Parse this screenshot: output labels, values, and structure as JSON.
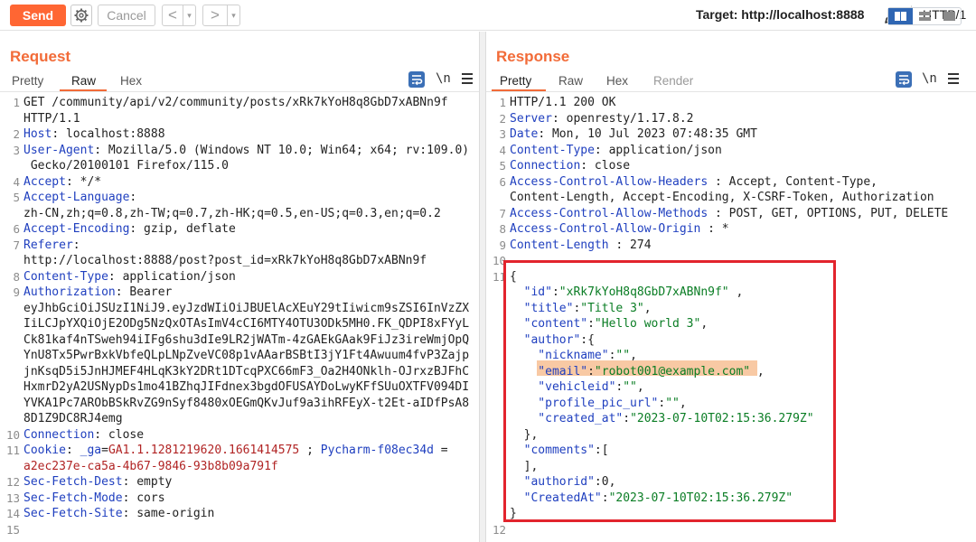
{
  "toolbar": {
    "send_label": "Send",
    "cancel_label": "Cancel",
    "back_glyph": "<",
    "forward_glyph": ">",
    "dropdown_glyph": "▾",
    "target_label": "Target: http://localhost:8888",
    "http_version": "HTTP/1",
    "send_color": "#ff6633"
  },
  "request": {
    "title": "Request",
    "tabs": [
      "Pretty",
      "Raw",
      "Hex"
    ],
    "active_tab": "Raw",
    "ln_icon": "\\n",
    "lines": [
      {
        "n": "1",
        "segs": [
          {
            "t": "GET /community/api/v2/community/posts/xRk7kYoH8q8GbD7xABNn9f",
            "c": ""
          }
        ]
      },
      {
        "n": "",
        "segs": [
          {
            "t": "HTTP/1.1",
            "c": ""
          }
        ]
      },
      {
        "n": "2",
        "segs": [
          {
            "t": "Host",
            "c": "key"
          },
          {
            "t": ": localhost:8888",
            "c": ""
          }
        ]
      },
      {
        "n": "3",
        "segs": [
          {
            "t": "User-Agent",
            "c": "key"
          },
          {
            "t": ": Mozilla/5.0 (Windows NT 10.0; Win64; x64; rv:109.0)",
            "c": ""
          }
        ]
      },
      {
        "n": "",
        "segs": [
          {
            "t": " Gecko/20100101 Firefox/115.0",
            "c": ""
          }
        ]
      },
      {
        "n": "4",
        "segs": [
          {
            "t": "Accept",
            "c": "key"
          },
          {
            "t": ": */*",
            "c": ""
          }
        ]
      },
      {
        "n": "5",
        "segs": [
          {
            "t": "Accept-Language",
            "c": "key"
          },
          {
            "t": ":",
            "c": ""
          }
        ]
      },
      {
        "n": "",
        "segs": [
          {
            "t": "zh-CN,zh;q=0.8,zh-TW;q=0.7,zh-HK;q=0.5,en-US;q=0.3,en;q=0.2",
            "c": ""
          }
        ]
      },
      {
        "n": "6",
        "segs": [
          {
            "t": "Accept-Encoding",
            "c": "key"
          },
          {
            "t": ": gzip, deflate",
            "c": ""
          }
        ]
      },
      {
        "n": "7",
        "segs": [
          {
            "t": "Referer",
            "c": "key"
          },
          {
            "t": ":",
            "c": ""
          }
        ]
      },
      {
        "n": "",
        "segs": [
          {
            "t": "http://localhost:8888/post?post_id=xRk7kYoH8q8GbD7xABNn9f",
            "c": ""
          }
        ]
      },
      {
        "n": "8",
        "segs": [
          {
            "t": "Content-Type",
            "c": "key"
          },
          {
            "t": ": application/json",
            "c": ""
          }
        ]
      },
      {
        "n": "9",
        "segs": [
          {
            "t": "Authorization",
            "c": "key"
          },
          {
            "t": ": Bearer",
            "c": ""
          }
        ]
      },
      {
        "n": "",
        "segs": [
          {
            "t": "eyJhbGciOiJSUzI1NiJ9.eyJzdWIiOiJBUElAcXEuY29tIiwicm9sZSI6InVzZX",
            "c": ""
          }
        ]
      },
      {
        "n": "",
        "segs": [
          {
            "t": "IiLCJpYXQiOjE2ODg5NzQxOTAsImV4cCI6MTY4OTU3ODk5MH0.FK_QDPI8xFYyL",
            "c": ""
          }
        ]
      },
      {
        "n": "",
        "segs": [
          {
            "t": "Ck81kaf4nTSweh94iIFg6shu3dIe9LR2jWATm-4zGAEkGAak9FiJz3ireWmjOpQ",
            "c": ""
          }
        ]
      },
      {
        "n": "",
        "segs": [
          {
            "t": "YnU8Tx5PwrBxkVbfeQLpLNpZveVC08p1vAAarBSBtI3jY1Ft4Awuum4fvP3Zajp",
            "c": ""
          }
        ]
      },
      {
        "n": "",
        "segs": [
          {
            "t": "jnKsqD5i5JnHJMEF4HLqK3kY2DRt1DTcqPXC66mF3_Oa2H4ONklh-OJrxzBJFhC",
            "c": ""
          }
        ]
      },
      {
        "n": "",
        "segs": [
          {
            "t": "HxmrD2yA2USNypDs1mo41BZhqJIFdnex3bgdOFUSAYDoLwyKFfSUuOXTFV094DI",
            "c": ""
          }
        ]
      },
      {
        "n": "",
        "segs": [
          {
            "t": "YVKA1Pc7ARObBSkRvZG9nSyf8480xOEGmQKvJuf9a3ihRFEyX-t2Et-aIDfPsA8",
            "c": ""
          }
        ]
      },
      {
        "n": "",
        "segs": [
          {
            "t": "8D1Z9DC8RJ4emg",
            "c": ""
          }
        ]
      },
      {
        "n": "10",
        "segs": [
          {
            "t": "Connection",
            "c": "key"
          },
          {
            "t": ": close",
            "c": ""
          }
        ]
      },
      {
        "n": "11",
        "segs": [
          {
            "t": "Cookie",
            "c": "key"
          },
          {
            "t": ": ",
            "c": ""
          },
          {
            "t": "_ga",
            "c": "key"
          },
          {
            "t": "=",
            "c": ""
          },
          {
            "t": "GA1.1.1281219620.1661414575",
            "c": "val-red"
          },
          {
            "t": " ; ",
            "c": ""
          },
          {
            "t": "Pycharm-f08ec34d",
            "c": "key"
          },
          {
            "t": " =",
            "c": ""
          }
        ]
      },
      {
        "n": "",
        "segs": [
          {
            "t": "a2ec237e-ca5a-4b67-9846-93b8b09a791f",
            "c": "val-red"
          }
        ]
      },
      {
        "n": "12",
        "segs": [
          {
            "t": "Sec-Fetch-Dest",
            "c": "key"
          },
          {
            "t": ": empty",
            "c": ""
          }
        ]
      },
      {
        "n": "13",
        "segs": [
          {
            "t": "Sec-Fetch-Mode",
            "c": "key"
          },
          {
            "t": ": cors",
            "c": ""
          }
        ]
      },
      {
        "n": "14",
        "segs": [
          {
            "t": "Sec-Fetch-Site",
            "c": "key"
          },
          {
            "t": ": same-origin",
            "c": ""
          }
        ]
      },
      {
        "n": "15",
        "segs": []
      }
    ]
  },
  "response": {
    "title": "Response",
    "tabs": [
      "Pretty",
      "Raw",
      "Hex",
      "Render"
    ],
    "active_tab": "Pretty",
    "ln_icon": "\\n",
    "lines": [
      {
        "n": "1",
        "segs": [
          {
            "t": "HTTP/1.1 200 OK",
            "c": ""
          }
        ]
      },
      {
        "n": "2",
        "segs": [
          {
            "t": "Server",
            "c": "key"
          },
          {
            "t": ": openresty/1.17.8.2",
            "c": ""
          }
        ]
      },
      {
        "n": "3",
        "segs": [
          {
            "t": "Date",
            "c": "key"
          },
          {
            "t": ": Mon, 10 Jul 2023 07:48:35 GMT",
            "c": ""
          }
        ]
      },
      {
        "n": "4",
        "segs": [
          {
            "t": "Content-Type",
            "c": "key"
          },
          {
            "t": ": application/json",
            "c": ""
          }
        ]
      },
      {
        "n": "5",
        "segs": [
          {
            "t": "Connection",
            "c": "key"
          },
          {
            "t": ": close",
            "c": ""
          }
        ]
      },
      {
        "n": "6",
        "segs": [
          {
            "t": "Access-Control-Allow-Headers",
            "c": "key"
          },
          {
            "t": " : Accept, Content-Type,",
            "c": ""
          }
        ]
      },
      {
        "n": "",
        "segs": [
          {
            "t": "Content-Length, Accept-Encoding, X-CSRF-Token, Authorization",
            "c": ""
          }
        ]
      },
      {
        "n": "7",
        "segs": [
          {
            "t": "Access-Control-Allow-Methods",
            "c": "key"
          },
          {
            "t": " : POST, GET, OPTIONS, PUT, DELETE",
            "c": ""
          }
        ]
      },
      {
        "n": "8",
        "segs": [
          {
            "t": "Access-Control-Allow-Origin",
            "c": "key"
          },
          {
            "t": " : *",
            "c": ""
          }
        ]
      },
      {
        "n": "9",
        "segs": [
          {
            "t": "Content-Length",
            "c": "key"
          },
          {
            "t": " : 274",
            "c": ""
          }
        ]
      },
      {
        "n": "10",
        "segs": []
      },
      {
        "n": "11",
        "segs": [
          {
            "t": "{",
            "c": ""
          }
        ]
      },
      {
        "n": "",
        "segs": [
          {
            "t": "  \"id\"",
            "c": "key"
          },
          {
            "t": ":",
            "c": ""
          },
          {
            "t": "\"xRk7kYoH8q8GbD7xABNn9f\"",
            "c": "str"
          },
          {
            "t": " ,",
            "c": ""
          }
        ]
      },
      {
        "n": "",
        "segs": [
          {
            "t": "  \"title\"",
            "c": "key"
          },
          {
            "t": ":",
            "c": ""
          },
          {
            "t": "\"Title 3\"",
            "c": "str"
          },
          {
            "t": ",",
            "c": ""
          }
        ]
      },
      {
        "n": "",
        "segs": [
          {
            "t": "  \"content\"",
            "c": "key"
          },
          {
            "t": ":",
            "c": ""
          },
          {
            "t": "\"Hello world 3\"",
            "c": "str"
          },
          {
            "t": ",",
            "c": ""
          }
        ]
      },
      {
        "n": "",
        "segs": [
          {
            "t": "  \"author\"",
            "c": "key"
          },
          {
            "t": ":{",
            "c": ""
          }
        ]
      },
      {
        "n": "",
        "segs": [
          {
            "t": "    \"nickname\"",
            "c": "key"
          },
          {
            "t": ":",
            "c": ""
          },
          {
            "t": "\"\"",
            "c": "str"
          },
          {
            "t": ",",
            "c": ""
          }
        ]
      },
      {
        "n": "",
        "segs": [
          {
            "t": "    \"email\"",
            "c": "key"
          },
          {
            "t": ":",
            "c": ""
          },
          {
            "t": "\"robot001@example.com\"",
            "c": "str"
          },
          {
            "t": " ,",
            "c": ""
          }
        ]
      },
      {
        "n": "",
        "segs": [
          {
            "t": "    \"vehicleid\"",
            "c": "key"
          },
          {
            "t": ":",
            "c": ""
          },
          {
            "t": "\"\"",
            "c": "str"
          },
          {
            "t": ",",
            "c": ""
          }
        ]
      },
      {
        "n": "",
        "segs": [
          {
            "t": "    \"profile_pic_url\"",
            "c": "key"
          },
          {
            "t": ":",
            "c": ""
          },
          {
            "t": "\"\"",
            "c": "str"
          },
          {
            "t": ",",
            "c": ""
          }
        ]
      },
      {
        "n": "",
        "segs": [
          {
            "t": "    \"created_at\"",
            "c": "key"
          },
          {
            "t": ":",
            "c": ""
          },
          {
            "t": "\"2023-07-10T02:15:36.279Z\"",
            "c": "str"
          }
        ]
      },
      {
        "n": "",
        "segs": [
          {
            "t": "  },",
            "c": ""
          }
        ]
      },
      {
        "n": "",
        "segs": [
          {
            "t": "  \"comments\"",
            "c": "key"
          },
          {
            "t": ":[",
            "c": ""
          }
        ]
      },
      {
        "n": "",
        "segs": [
          {
            "t": "  ],",
            "c": ""
          }
        ]
      },
      {
        "n": "",
        "segs": [
          {
            "t": "  \"authorid\"",
            "c": "key"
          },
          {
            "t": ":0,",
            "c": ""
          }
        ]
      },
      {
        "n": "",
        "segs": [
          {
            "t": "  \"CreatedAt\"",
            "c": "key"
          },
          {
            "t": ":",
            "c": ""
          },
          {
            "t": "\"2023-07-10T02:15:36.279Z\"",
            "c": "str"
          }
        ]
      },
      {
        "n": "",
        "segs": [
          {
            "t": "}",
            "c": ""
          }
        ]
      },
      {
        "n": "12",
        "segs": []
      }
    ]
  },
  "colors": {
    "accent": "#f26b38",
    "key": "#1f3fbf",
    "string": "#0a7d24",
    "cookie_value": "#b12424",
    "highlight_box": "#e2242d",
    "email_highlight": "#f8c9a4"
  }
}
